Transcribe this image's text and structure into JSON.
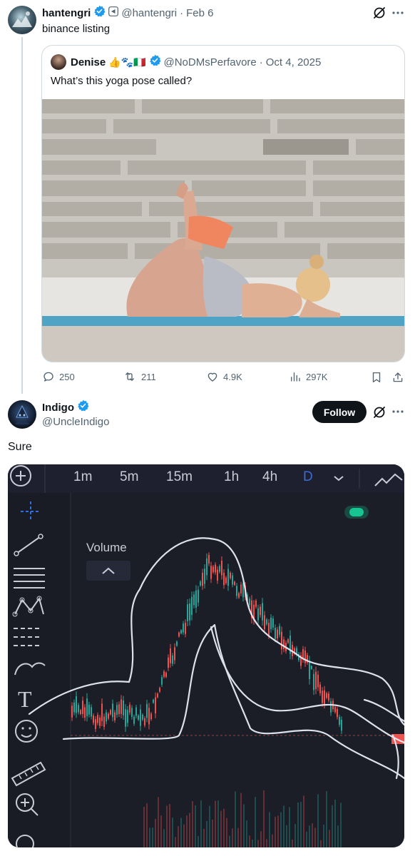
{
  "tweet": {
    "author_name": "hantengri",
    "handle": "@hantengri",
    "date": "Feb 6",
    "separator": "·",
    "text": "binance listing",
    "quoted": {
      "author_name": "Denise",
      "emoji_label": "👍🐾🇮🇹",
      "handle": "@NoDMsPerfavore",
      "date": "Oct 4, 2025",
      "separator": "·",
      "text": "What’s this yoga pose called?"
    },
    "actions": {
      "replies": "250",
      "reposts": "211",
      "likes": "4.9K",
      "views": "297K"
    }
  },
  "reply": {
    "author_name": "Indigo",
    "handle": "@UncleIndigo",
    "follow_label": "Follow",
    "text": "Sure",
    "chart": {
      "timeframes": [
        "1m",
        "5m",
        "15m",
        "1h",
        "4h",
        "D"
      ],
      "active_timeframe": "D",
      "volume_label": "Volume"
    }
  },
  "colors": {
    "verified": "#1d9bf0",
    "accent_blue": "#1d9bf0",
    "secondary_text": "#536471",
    "candle_up": "#26a69a",
    "candle_down": "#ef5350",
    "chart_bg": "#1b1d27"
  },
  "icons": [
    "verified-badge-icon",
    "grok-icon",
    "more-icon",
    "reply-icon",
    "repost-icon",
    "like-icon",
    "views-icon",
    "bookmark-icon",
    "share-icon"
  ]
}
